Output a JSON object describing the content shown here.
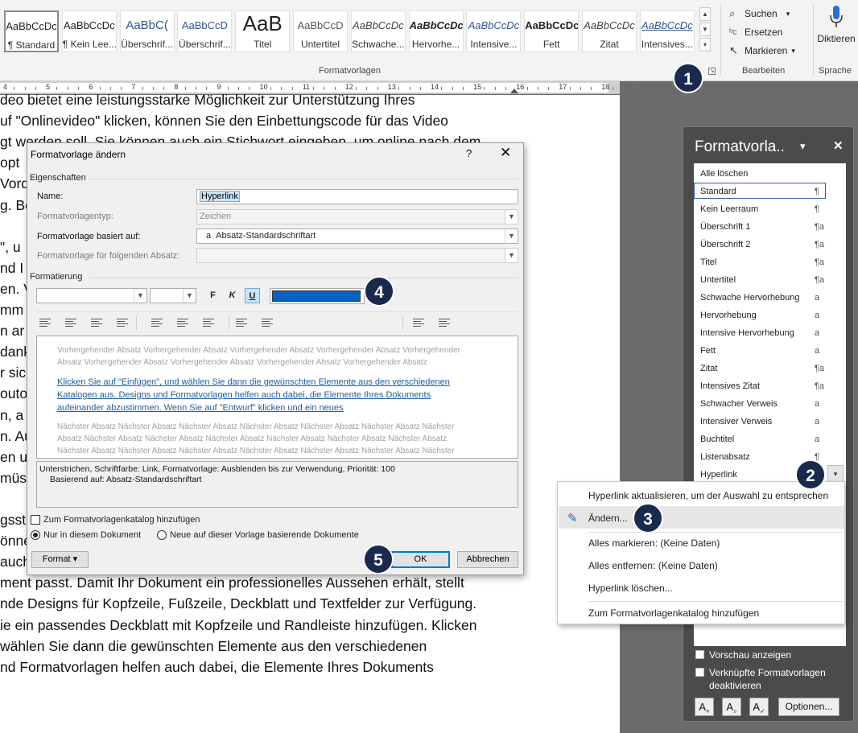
{
  "ribbon": {
    "styles": [
      {
        "preview": "AaBbCcDc",
        "name": "¶ Standard"
      },
      {
        "preview": "AaBbCcDc",
        "name": "¶ Kein Lee..."
      },
      {
        "preview": "AaBbC(",
        "name": "Überschrif..."
      },
      {
        "preview": "AaBbCcD",
        "name": "Überschrif..."
      },
      {
        "preview": "AaB",
        "name": "Titel"
      },
      {
        "preview": "AaBbCcD",
        "name": "Untertitel"
      },
      {
        "preview": "AaBbCcDc",
        "name": "Schwache..."
      },
      {
        "preview": "AaBbCcDc",
        "name": "Hervorhe..."
      },
      {
        "preview": "AaBbCcDc",
        "name": "Intensive..."
      },
      {
        "preview": "AaBbCcDc",
        "name": "Fett"
      },
      {
        "preview": "AaBbCcDc",
        "name": "Zitat"
      },
      {
        "preview": "AaBbCcDc",
        "name": "Intensives..."
      }
    ],
    "group_formatvorlagen": "Formatvorlagen",
    "edit": {
      "suchen": "Suchen",
      "ersetzen": "Ersetzen",
      "markieren": "Markieren",
      "group": "Bearbeiten"
    },
    "speech": {
      "diktieren": "Diktieren",
      "group": "Sprache"
    }
  },
  "ruler": {
    "numbers": [
      "4",
      "5",
      "6",
      "7",
      "8",
      "9",
      "10",
      "11",
      "12",
      "13",
      "14",
      "15",
      "16",
      "17",
      "18"
    ]
  },
  "document": {
    "lines": [
      "deo bietet eine leistungsstarke Möglichkeit zur Unterstützung Ihres",
      "uf \"Onlinevideo\" klicken, können Sie den Einbettungscode für das Video",
      "gt werden soll. Sie können auch ein Stichwort eingeben, um online nach dem",
      " opt",
      "Vord",
      "g. Be",
      "",
      "\", u",
      "nd I",
      "en. V",
      "mm",
      "n ar",
      "dank",
      "r sic",
      "outo",
      "n, a",
      "n. Au",
      "en u",
      "müs",
      "",
      "gsst",
      "önnen Sie den Einbettungscode für das Video einfügen, das hinzugefügt",
      "auch ein Stichwort eingeben, um online nach dem Videoclip zu suchen, der",
      "ment passt. Damit Ihr Dokument ein professionelles Aussehen erhält, stellt",
      "nde Designs für Kopfzeile, Fußzeile, Deckblatt und Textfelder zur Verfügung.",
      "ie ein passendes Deckblatt mit Kopfzeile und Randleiste hinzufügen. Klicken",
      "wählen Sie dann die gewünschten Elemente aus den verschiedenen",
      "nd Formatvorlagen helfen auch dabei, die Elemente Ihres Dokuments"
    ]
  },
  "dialog": {
    "title": "Formatvorlage ändern",
    "help": "?",
    "close": "✕",
    "section_properties": "Eigenschaften",
    "name_label": "Name:",
    "name_value": "Hyperlink",
    "type_label": "Formatvorlagentyp:",
    "type_value": "Zeichen",
    "based_label": "Formatvorlage basiert auf:",
    "based_value": "Absatz-Standardschriftart",
    "based_glyph": "a",
    "next_label": "Formatvorlage für folgenden Absatz:",
    "next_value": "",
    "section_format": "Formatierung",
    "bold": "F",
    "italic": "K",
    "underline": "U",
    "color": "#0563c1",
    "preview_prev": [
      "Vorhergehender Absatz Vorhergehender Absatz Vorhergehender Absatz Vorhergehender Absatz Vorhergehender",
      "Absatz Vorhergehender Absatz Vorhergehender Absatz Vorhergehender Absatz Vorhergehender Absatz"
    ],
    "preview_link": [
      "Klicken Sie auf \"Einfügen\", und wählen Sie dann die gewünschten Elemente aus den verschiedenen",
      "Katalogen aus. Designs und Formatvorlagen helfen auch dabei, die Elemente Ihres Dokuments",
      "aufeinander abzustimmen. Wenn Sie auf \"Entwurf\" klicken und ein neues"
    ],
    "preview_next": [
      "Nächster Absatz Nächster Absatz Nächster Absatz Nächster Absatz Nächster Absatz Nächster Absatz Nächster",
      "Absatz Nächster Absatz Nächster Absatz Nächster Absatz Nächster Absatz Nächster Absatz Nächster Absatz",
      "Nächster Absatz Nächster Absatz Nächster Absatz Nächster Absatz Nächster Absatz Nächster Absatz Nächster"
    ],
    "description_1": "Unterstrichen, Schriftfarbe: Link, Formatvorlage: Ausblenden bis zur Verwendung, Priorität: 100",
    "description_2": "Basierend auf: Absatz-Standardschriftart",
    "add_to_gallery": "Zum Formatvorlagenkatalog hinzufügen",
    "only_this_doc": "Nur in diesem Dokument",
    "new_docs": "Neue auf dieser Vorlage basierende Dokumente",
    "format_btn": "Format ▾",
    "ok": "OK",
    "cancel": "Abbrechen"
  },
  "pane": {
    "title": "Formatvorla..",
    "dropdown": "▾",
    "close": "✕",
    "items": [
      {
        "name": "Alle löschen",
        "glyph": ""
      },
      {
        "name": "Standard",
        "glyph": "¶"
      },
      {
        "name": "Kein Leerraum",
        "glyph": "¶"
      },
      {
        "name": "Überschrift 1",
        "glyph": "¶a"
      },
      {
        "name": "Überschrift 2",
        "glyph": "¶a"
      },
      {
        "name": "Titel",
        "glyph": "¶a"
      },
      {
        "name": "Untertitel",
        "glyph": "¶a"
      },
      {
        "name": "Schwache Hervorhebung",
        "glyph": "a"
      },
      {
        "name": "Hervorhebung",
        "glyph": "a"
      },
      {
        "name": "Intensive Hervorhebung",
        "glyph": "a"
      },
      {
        "name": "Fett",
        "glyph": "a"
      },
      {
        "name": "Zitat",
        "glyph": "¶a"
      },
      {
        "name": "Intensives Zitat",
        "glyph": "¶a"
      },
      {
        "name": "Schwacher Verweis",
        "glyph": "a"
      },
      {
        "name": "Intensiver Verweis",
        "glyph": "a"
      },
      {
        "name": "Buchtitel",
        "glyph": "a"
      },
      {
        "name": "Listenabsatz",
        "glyph": "¶"
      },
      {
        "name": "Hyperlink",
        "glyph": ""
      }
    ],
    "preview_label": "Vorschau anzeigen",
    "linked_label_1": "Verknüpfte Formatvorlagen",
    "linked_label_2": "deaktivieren",
    "options": "Optionen..."
  },
  "context_menu": {
    "items": [
      "Hyperlink aktualisieren, um der Auswahl zu entsprechen",
      "Ändern...",
      "Alles markieren: (Keine Daten)",
      "Alles entfernen: (Keine Daten)",
      "Hyperlink löschen...",
      "Zum Formatvorlagenkatalog hinzufügen"
    ]
  },
  "badges": [
    "1",
    "2",
    "3",
    "4",
    "5"
  ]
}
